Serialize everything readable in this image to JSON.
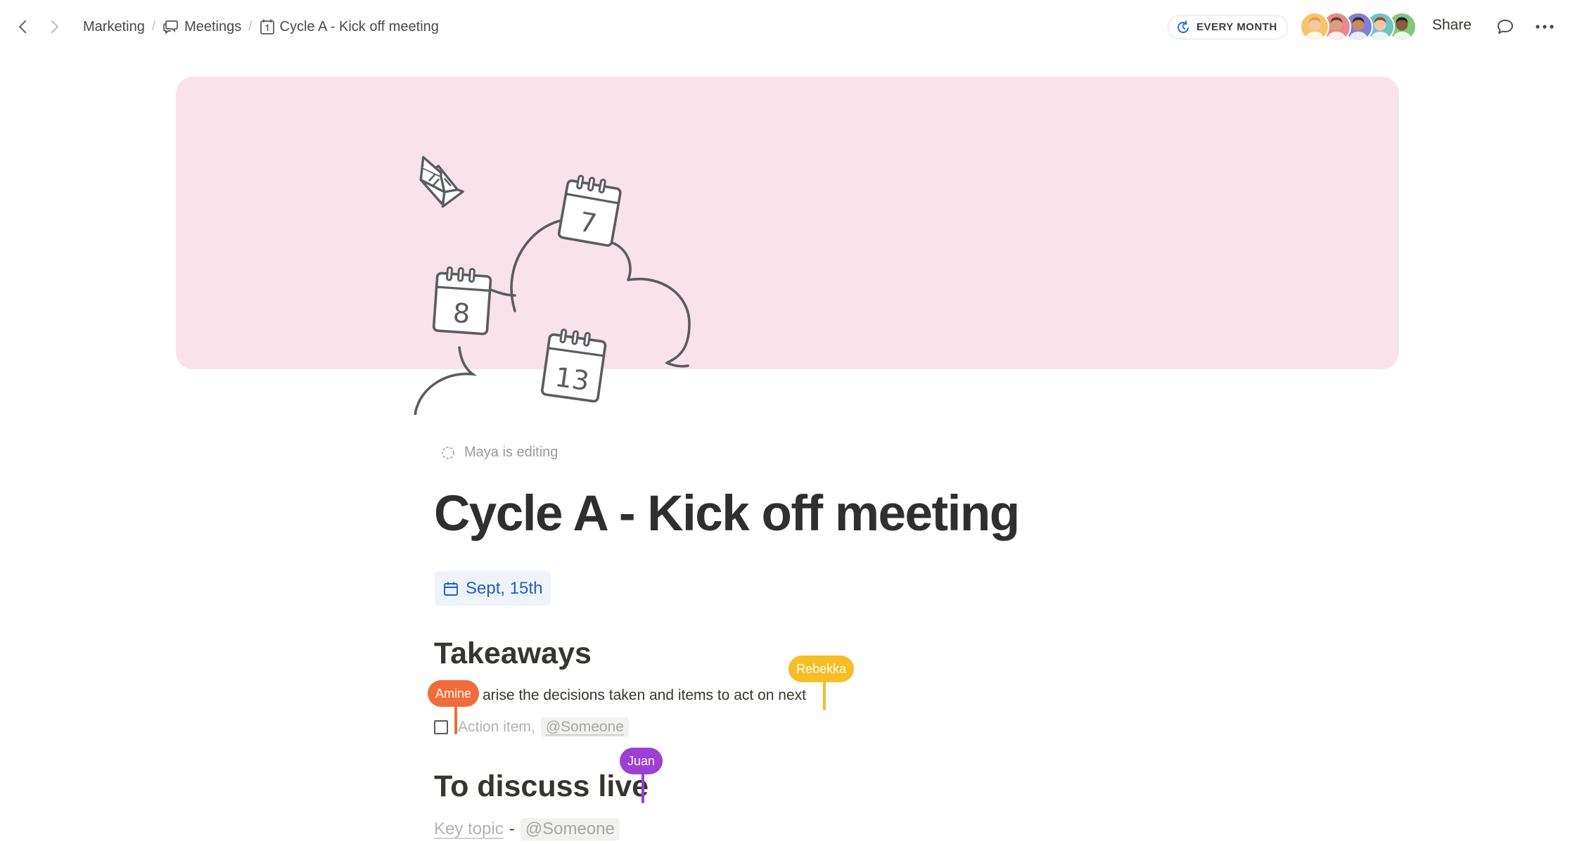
{
  "breadcrumb": {
    "items": [
      "Marketing",
      "Meetings",
      "Cycle A - Kick off meeting"
    ],
    "separator": "/"
  },
  "recurrence": {
    "label": "EVERY MONTH"
  },
  "collaborators": [
    {
      "bg": "#f5c56b",
      "skin": "#f1c9a5",
      "hair": "#e7a23a"
    },
    {
      "bg": "#e98a8a",
      "skin": "#d9a07c",
      "hair": "#6b3b2a"
    },
    {
      "bg": "#7f7fd8",
      "skin": "#c98b5e",
      "hair": "#2c2c2c"
    },
    {
      "bg": "#6fc3c7",
      "skin": "#f0c8a6",
      "hair": "#8a4f2b"
    },
    {
      "bg": "#7fc97a",
      "skin": "#8d5a3a",
      "hair": "#1f1f1f"
    }
  ],
  "header": {
    "share_label": "Share"
  },
  "cover": {
    "calendar_numbers": [
      "7",
      "8",
      "13"
    ]
  },
  "status": {
    "editing_text": "Maya is editing"
  },
  "page": {
    "title": "Cycle A - Kick off meeting",
    "date": "Sept, 15th"
  },
  "takeaways": {
    "heading": "Takeaways",
    "summary_visible": "arise the decisions taken and items to act on next",
    "action_placeholder": "Action item,",
    "mention": "@Someone"
  },
  "discuss": {
    "heading": "To discuss live",
    "topic": "Key topic",
    "dash": "-",
    "mention": "@Someone"
  },
  "cursors": {
    "amine": {
      "name": "Amine",
      "color": "#f26b3a"
    },
    "rebekka": {
      "name": "Rebekka",
      "color": "#f6bd25"
    },
    "juan": {
      "name": "Juan",
      "color": "#9b3fd6"
    }
  }
}
